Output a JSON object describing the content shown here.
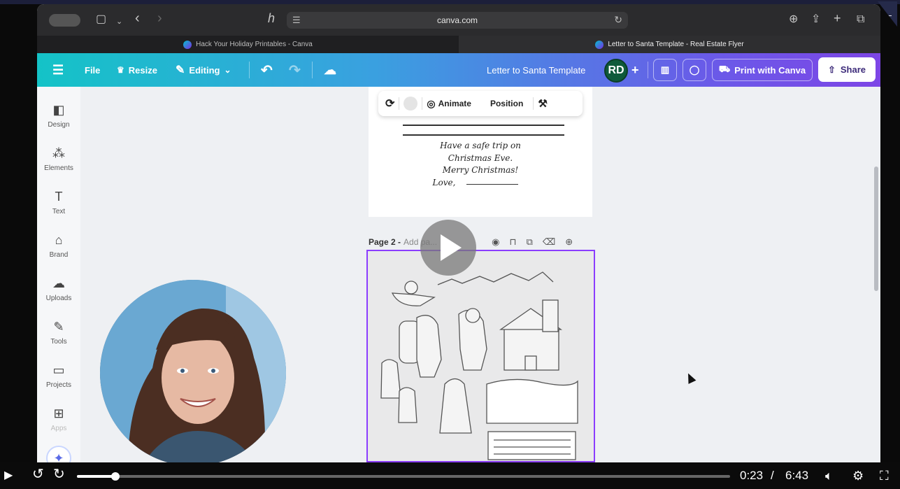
{
  "browser": {
    "url": "canva.com",
    "tabs": [
      {
        "label": "Hack Your Holiday Printables - Canva",
        "active": false
      },
      {
        "label": "Letter to Santa Template - Real Estate Flyer",
        "active": true
      }
    ]
  },
  "header": {
    "file_label": "File",
    "resize_label": "Resize",
    "editing_label": "Editing",
    "design_title": "Letter to Santa Template",
    "avatar_initials": "RD",
    "print_label": "Print with Canva",
    "share_label": "Share"
  },
  "sidebar": {
    "items": [
      {
        "label": "Design",
        "icon": "layout-icon"
      },
      {
        "label": "Elements",
        "icon": "shapes-icon"
      },
      {
        "label": "Text",
        "icon": "text-icon"
      },
      {
        "label": "Brand",
        "icon": "brand-icon"
      },
      {
        "label": "Uploads",
        "icon": "upload-icon"
      },
      {
        "label": "Tools",
        "icon": "tools-icon"
      },
      {
        "label": "Projects",
        "icon": "folder-icon"
      },
      {
        "label": "Apps",
        "icon": "apps-icon"
      }
    ]
  },
  "float_toolbar": {
    "animate_label": "Animate",
    "position_label": "Position"
  },
  "page1": {
    "lines": [
      "Have a safe trip on",
      "Christmas Eve.",
      "Merry Christmas!",
      "Love,"
    ]
  },
  "page2": {
    "label": "Page 2 -",
    "placeholder": "Add pa..."
  },
  "video": {
    "current_time": "0:23",
    "separator": "/",
    "duration": "6:43",
    "progress": 0.059
  },
  "colors": {
    "accent_purple": "#8b3dff",
    "header_start": "#14c3c7",
    "header_end": "#7d45e6"
  }
}
